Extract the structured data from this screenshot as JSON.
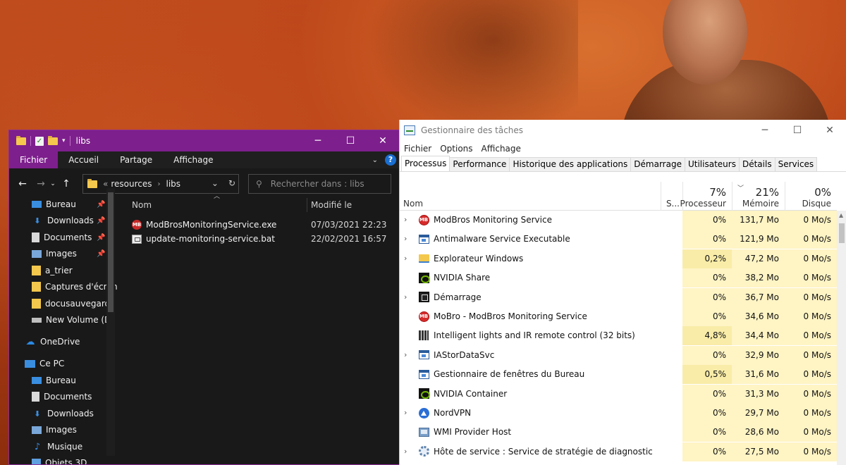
{
  "explorer": {
    "title": "libs",
    "ribbon_tabs": [
      {
        "label": "Fichier",
        "active": true
      },
      {
        "label": "Accueil",
        "active": false
      },
      {
        "label": "Partage",
        "active": false
      },
      {
        "label": "Affichage",
        "active": false
      }
    ],
    "address": {
      "prefix": "«",
      "crumbs": [
        "resources",
        "libs"
      ]
    },
    "search": {
      "placeholder": "Rechercher dans : libs"
    },
    "sidebar": [
      {
        "label": "Bureau",
        "icon": "desktop-icon",
        "pinned": true
      },
      {
        "label": "Downloads",
        "icon": "download-icon",
        "pinned": true
      },
      {
        "label": "Documents",
        "icon": "documents-icon",
        "pinned": true
      },
      {
        "label": "Images",
        "icon": "images-icon",
        "pinned": true
      },
      {
        "label": "a_trier",
        "icon": "folder-icon",
        "pinned": false
      },
      {
        "label": "Captures d'écran",
        "icon": "folder-icon",
        "pinned": false
      },
      {
        "label": "docusauvegarde",
        "icon": "folder-icon",
        "pinned": false
      },
      {
        "label": "New Volume (D:",
        "icon": "drive-icon",
        "pinned": false
      },
      {
        "label": "OneDrive",
        "icon": "onedrive-icon",
        "pinned": false
      },
      {
        "label": "Ce PC",
        "icon": "computer-icon",
        "pinned": false
      },
      {
        "label": "Bureau",
        "icon": "desktop-icon",
        "pinned": false
      },
      {
        "label": "Documents",
        "icon": "documents-icon",
        "pinned": false
      },
      {
        "label": "Downloads",
        "icon": "download-icon",
        "pinned": false
      },
      {
        "label": "Images",
        "icon": "images-icon",
        "pinned": false
      },
      {
        "label": "Musique",
        "icon": "music-icon",
        "pinned": false
      },
      {
        "label": "Objets 3D",
        "icon": "objects3d-icon",
        "pinned": false
      }
    ],
    "columns": {
      "name": "Nom",
      "modified": "Modifié le"
    },
    "files": [
      {
        "name": "ModBrosMonitoringService.exe",
        "modified": "07/03/2021 22:23",
        "icon": "exe-icon"
      },
      {
        "name": "update-monitoring-service.bat",
        "modified": "22/02/2021 16:57",
        "icon": "bat-icon"
      }
    ]
  },
  "taskmgr": {
    "title": "Gestionnaire des tâches",
    "menu": [
      "Fichier",
      "Options",
      "Affichage"
    ],
    "tabs": [
      {
        "label": "Processus",
        "active": true
      },
      {
        "label": "Performance",
        "active": false
      },
      {
        "label": "Historique des applications",
        "active": false
      },
      {
        "label": "Démarrage",
        "active": false
      },
      {
        "label": "Utilisateurs",
        "active": false
      },
      {
        "label": "Détails",
        "active": false
      },
      {
        "label": "Services",
        "active": false
      }
    ],
    "headers": {
      "name": "Nom",
      "status": "S...",
      "cpu_pct": "7%",
      "cpu_label": "Processeur",
      "mem_pct": "21%",
      "mem_label": "Mémoire",
      "disk_pct": "0%",
      "disk_label": "Disque"
    },
    "processes": [
      {
        "name": "ModBros Monitoring Service",
        "expand": true,
        "icon": "mobro-icon",
        "cpu": "0%",
        "mem": "131,7 Mo",
        "disk": "0 Mo/s"
      },
      {
        "name": "Antimalware Service Executable",
        "expand": true,
        "icon": "window-icon",
        "cpu": "0%",
        "mem": "121,9 Mo",
        "disk": "0 Mo/s"
      },
      {
        "name": "Explorateur Windows",
        "expand": true,
        "icon": "folder-icon",
        "cpu": "0,2%",
        "mem": "47,2 Mo",
        "disk": "0 Mo/s"
      },
      {
        "name": "NVIDIA Share",
        "expand": false,
        "icon": "nvidia-icon",
        "cpu": "0%",
        "mem": "38,2 Mo",
        "disk": "0 Mo/s"
      },
      {
        "name": "Démarrage",
        "expand": true,
        "icon": "startup-icon",
        "cpu": "0%",
        "mem": "36,7 Mo",
        "disk": "0 Mo/s"
      },
      {
        "name": "MoBro - ModBros Monitoring Service",
        "expand": false,
        "icon": "mobro-icon",
        "cpu": "0%",
        "mem": "34,6 Mo",
        "disk": "0 Mo/s"
      },
      {
        "name": "Intelligent lights and IR remote control (32 bits)",
        "expand": false,
        "icon": "grid-icon",
        "cpu": "4,8%",
        "mem": "34,4 Mo",
        "disk": "0 Mo/s"
      },
      {
        "name": "IAStorDataSvc",
        "expand": true,
        "icon": "window-icon",
        "cpu": "0%",
        "mem": "32,9 Mo",
        "disk": "0 Mo/s"
      },
      {
        "name": "Gestionnaire de fenêtres du Bureau",
        "expand": false,
        "icon": "window-icon",
        "cpu": "0,5%",
        "mem": "31,6 Mo",
        "disk": "0 Mo/s"
      },
      {
        "name": "NVIDIA Container",
        "expand": false,
        "icon": "nvidia-icon",
        "cpu": "0%",
        "mem": "31,3 Mo",
        "disk": "0 Mo/s"
      },
      {
        "name": "NordVPN",
        "expand": true,
        "icon": "vpn-icon",
        "cpu": "0%",
        "mem": "29,7 Mo",
        "disk": "0 Mo/s"
      },
      {
        "name": "WMI Provider Host",
        "expand": false,
        "icon": "wmi-icon",
        "cpu": "0%",
        "mem": "28,6 Mo",
        "disk": "0 Mo/s"
      },
      {
        "name": "Hôte de service : Service de stratégie de diagnostic",
        "expand": true,
        "icon": "gear-icon",
        "cpu": "0%",
        "mem": "27,5 Mo",
        "disk": "0 Mo/s"
      }
    ]
  },
  "colors": {
    "explorer_accent": "#7d1f8c",
    "heat_light": "#fff4c4",
    "heat_medium": "#f9eca8"
  }
}
